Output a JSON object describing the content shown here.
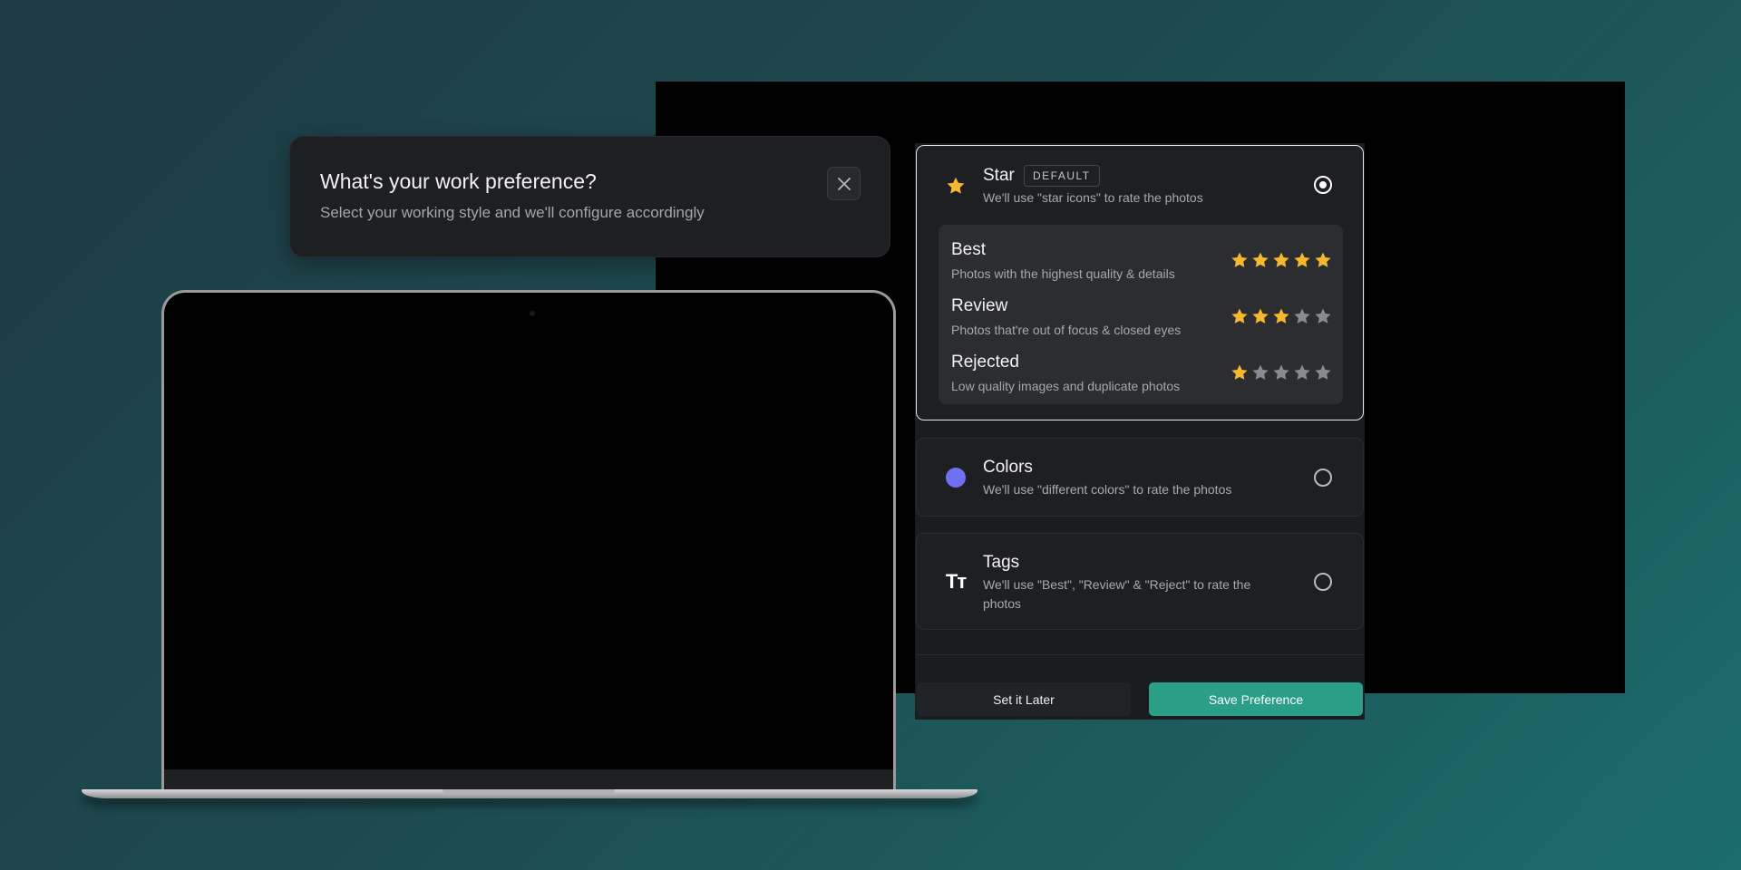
{
  "header": {
    "title": "What's your work preference?",
    "subtitle": "Select your working style and we'll configure accordingly",
    "close_icon": "close-icon"
  },
  "options": [
    {
      "title": "Star",
      "badge": "DEFAULT",
      "description": "We'll use \"star icons\" to rate the photos",
      "icon": "star-icon",
      "selected": true,
      "levels": [
        {
          "title": "Best",
          "description": "Photos with the highest quality & details",
          "rating": 5,
          "max": 5
        },
        {
          "title": "Review",
          "description": "Photos that're out of focus & closed eyes",
          "rating": 3,
          "max": 5
        },
        {
          "title": "Rejected",
          "description": "Low quality images and duplicate photos",
          "rating": 1,
          "max": 5
        }
      ]
    },
    {
      "title": "Colors",
      "description": "We'll use \"different colors\" to rate the photos",
      "icon": "color-dot-icon",
      "selected": false
    },
    {
      "title": "Tags",
      "description": "We'll use \"Best\", \"Review\" & \"Reject\" to rate the photos",
      "icon": "text-tag-icon",
      "icon_text": "Tт",
      "selected": false
    }
  ],
  "actions": {
    "later_label": "Set it Later",
    "save_label": "Save Preference"
  },
  "colors": {
    "accent": "#2b9e86",
    "star_filled": "#f5b82e",
    "star_empty": "#8a8b8f",
    "color_dot": "#6e72f0"
  }
}
